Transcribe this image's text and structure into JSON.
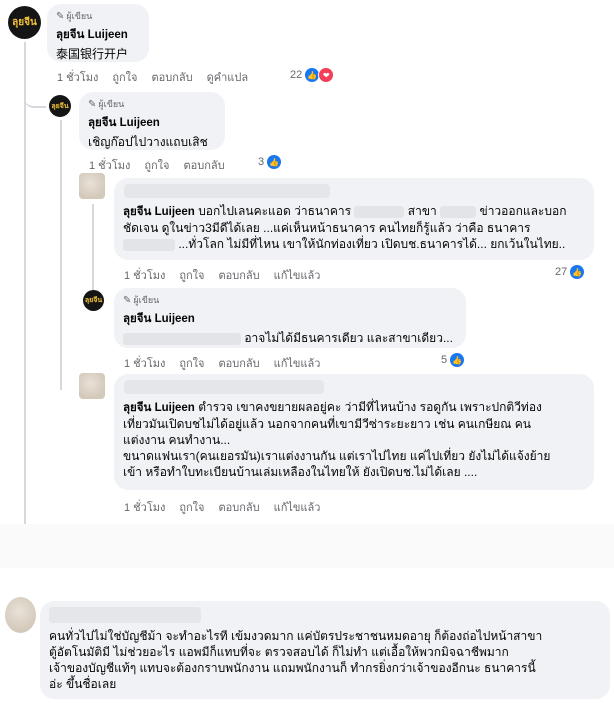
{
  "page": {
    "brand_logo": "ลุยจีน"
  },
  "c1": {
    "badge": "ผู้เขียน",
    "author": "ลุยจีน Luijeen",
    "text": "泰国银行开户",
    "time": "1 ชั่วโมง",
    "like": "ถูกใจ",
    "reply": "ตอบกลับ",
    "translate": "ดูคำแปล",
    "count": "22"
  },
  "c2": {
    "badge": "ผู้เขียน",
    "author": "ลุยจีน Luijeen",
    "text": "เชิญก๊อปไปวางแถบเสิช",
    "time": "1 ชั่วโมง",
    "like": "ถูกใจ",
    "reply": "ตอบกลับ",
    "count": "3"
  },
  "c3": {
    "author": "ลุยจีน Luijeen",
    "line1_a": "บอกไปเลนคะแอด ว่าธนาคาร",
    "line1_b": "สาขา",
    "line1_c": "ข่าวออกและบอก",
    "line2": "ชัดเจน ดูในข่าว3มีดีได้เลย ...แค่เห็นหน้าธนาคาร คนไทยก็รู้แล้ว ว่าคือ ธนาคาร",
    "line3": "...ทั่วโลก ไม่มีที่ไหน เขาให้นักท่องเที่ยว เปิดบช.ธนาคารได้... ยกเว้นในไทย..",
    "time": "1 ชั่วโมง",
    "like": "ถูกใจ",
    "reply": "ตอบกลับ",
    "edited": "แก้ไขแล้ว",
    "count": "27"
  },
  "c4": {
    "badge": "ผู้เขียน",
    "author": "ลุยจีน Luijeen",
    "text": "อาจไม่ได้มีธนคารเดียว และสาขาเดียว...",
    "time": "1 ชั่วโมง",
    "like": "ถูกใจ",
    "reply": "ตอบกลับ",
    "edited": "แก้ไขแล้ว",
    "count": "5"
  },
  "c5": {
    "author": "ลุยจีน Luijeen",
    "lines": [
      "ตำรวจ เขาคงขยายผลอยู่คะ ว่ามีที่ไหนบ้าง รอดูกัน เพราะปกติวีท่อง",
      "เที่ยวมันเปิดบชไม่ได้อยู่แล้ว นอกจากคนที่เขามีวีซ่าระยะยาว เช่น คนเกษียณ คน",
      "แต่งงาน คนทำงาน...",
      "ขนาดแฟนเรา(คนเยอรมัน)เราแต่งงานกัน แต่เราไปไทย แค่ไปเที่ยว ยังไม่ได้แจ้งย้าย",
      "เข้า หรือทำใบทะเบียนบ้านเล่มเหลืองในไทยให้ ยังเปิดบช.ไม่ได้เลย ...."
    ],
    "time": "1 ชั่วโมง",
    "like": "ถูกใจ",
    "reply": "ตอบกลับ",
    "edited": "แก้ไขแล้ว"
  },
  "c6": {
    "lines": [
      "คนทั่วไปไม่ใช่บัญชีม้า จะทำอะไรที เข้มงวดมาก แค่บัตรประชาชนหมดอายุ ก็ต้องถ่อไปหน้าสาขา",
      "ตู้อัตโนมัติมี ไม่ช่วยอะไร แอพมีก็แทบที่จะ ตรวจสอบได้ ก็ไม่ทำ แต่เอื้อให้พวกมิจฉาชีพมาก",
      "เจ้าของบัญชีแท้ๆ แทบจะต้องกราบพนักงาน แถมพนักงานก็ ทำกรยิ่งกว่าเจ้าของอีกนะ ธนาคารนี้",
      "อ่ะ ขึ้นชื่อเลย"
    ]
  }
}
